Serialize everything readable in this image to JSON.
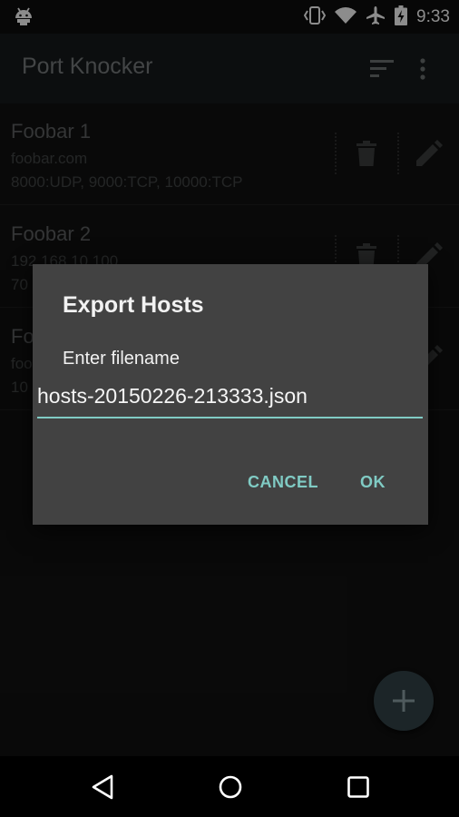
{
  "status_bar": {
    "time": "9:33",
    "icons": [
      "android-icon",
      "vibrate-icon",
      "wifi-icon",
      "airplane-icon",
      "battery-charging-icon"
    ]
  },
  "app_bar": {
    "title": "Port Knocker",
    "actions": [
      "sort-icon",
      "overflow-menu-icon"
    ]
  },
  "hosts": [
    {
      "name": "Foobar 1",
      "address": "foobar.com",
      "ports": "8000:UDP, 9000:TCP, 10000:TCP"
    },
    {
      "name": "Foobar 2",
      "address": "192.168.10.100",
      "ports": "70"
    },
    {
      "name": "Fo",
      "address": "foo",
      "ports": "10"
    }
  ],
  "dialog": {
    "title": "Export Hosts",
    "label": "Enter filename",
    "filename": "hosts-20150226-213333.json",
    "cancel_label": "CANCEL",
    "ok_label": "OK"
  },
  "fab": {
    "icon": "add-icon"
  },
  "nav_bar": {
    "icons": [
      "back-icon",
      "home-icon",
      "recents-icon"
    ]
  },
  "colors": {
    "accent": "#80cbc4",
    "dialog_background": "#424242",
    "app_bar": "#161a1c",
    "content_background": "#121212"
  }
}
